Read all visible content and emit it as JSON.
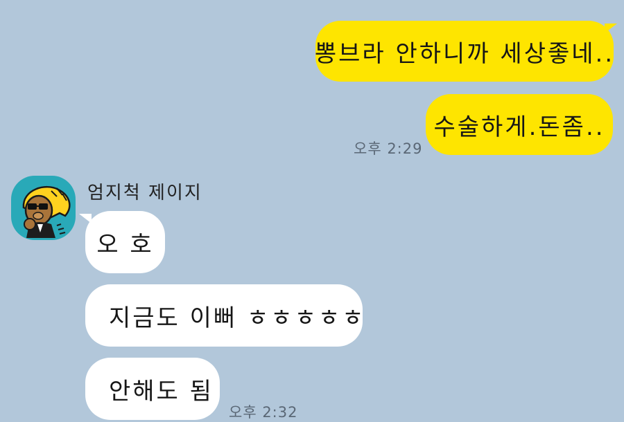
{
  "chat": {
    "sent_messages": [
      "뽕브라 안하니까 세상좋네..",
      "수술하게.돈좀.."
    ],
    "sent_time": "오후 2:29",
    "sender": {
      "name": "엄지척 제이지"
    },
    "received_messages": [
      "오 호",
      "지금도 이뻐 ㅎㅎㅎㅎㅎ",
      "안해도 됨"
    ],
    "received_time": "오후 2:32"
  },
  "colors": {
    "background": "#b2c7da",
    "my_bubble": "#fee500",
    "their_bubble": "#ffffff",
    "avatar_background": "#29a9b8"
  },
  "icons": {
    "avatar": "sunglasses-character-avatar-icon"
  }
}
